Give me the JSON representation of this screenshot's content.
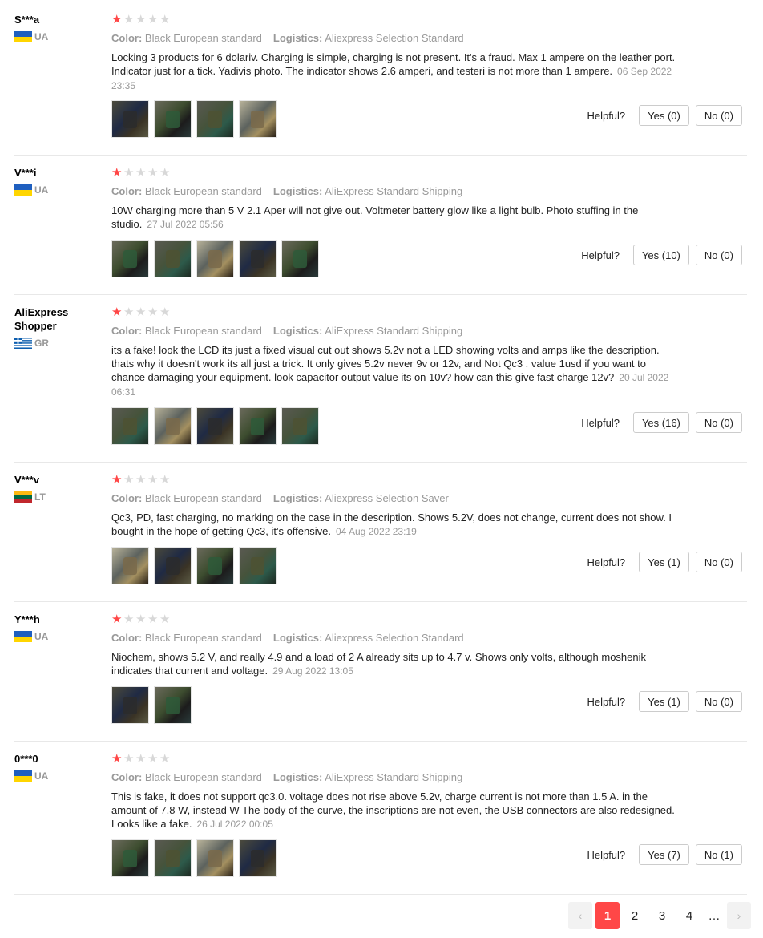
{
  "labels": {
    "color": "Color:",
    "logistics": "Logistics:",
    "helpful": "Helpful?"
  },
  "colors": {
    "accent": "#ff4747",
    "muted": "#999999",
    "border": "#e8e8e8"
  },
  "reviews": [
    {
      "user": "S***a",
      "country": "UA",
      "flag": "ukraine-flag-icon",
      "rating": 1,
      "color": "Black European standard",
      "logistics": "Aliexpress Selection Standard",
      "text": "Locking 3 products for 6 dolariv. Charging is simple, charging is not present. It's a fraud. Max 1 ampere on the leather port. Indicator just for a tick. Yadivis photo. The indicator shows 2.6 amperi, and testeri is not more than 1 ampere.",
      "date": "06 Sep 2022 23:35",
      "photos": [
        "charger-photo-1",
        "charger-photo-2",
        "charger-photo-3",
        "charger-photo-4"
      ],
      "yes": "Yes (0)",
      "no": "No (0)"
    },
    {
      "user": "V***i",
      "country": "UA",
      "flag": "ukraine-flag-icon",
      "rating": 1,
      "color": "Black European standard",
      "logistics": "AliExpress Standard Shipping",
      "text": "10W charging more than 5 V 2.1 Aper will not give out. Voltmeter battery glow like a light bulb. Photo stuffing in the studio.",
      "date": "27 Jul 2022 05:56",
      "photos": [
        "charger-photo-1",
        "charger-photo-2",
        "charger-photo-3",
        "charger-photo-4",
        "charger-photo-5"
      ],
      "yes": "Yes (10)",
      "no": "No (0)"
    },
    {
      "user": "AliExpress Shopper",
      "country": "GR",
      "flag": "greece-flag-icon",
      "rating": 1,
      "color": "Black European standard",
      "logistics": "AliExpress Standard Shipping",
      "text": "its a fake! look the LCD its just a fixed visual cut out shows 5.2v not a LED showing volts and amps like the description. thats why it doesn't work its all just a trick. It only gives 5.2v never 9v or 12v, and Not Qc3 . value 1usd if you want to chance damaging your equipment. look capacitor output value its on 10v? how can this give fast charge 12v?",
      "date": "20 Jul 2022 06:31",
      "photos": [
        "charger-photo-1",
        "charger-photo-2",
        "charger-photo-3",
        "charger-photo-4",
        "charger-photo-5"
      ],
      "yes": "Yes (16)",
      "no": "No (0)"
    },
    {
      "user": "V***v",
      "country": "LT",
      "flag": "lithuania-flag-icon",
      "rating": 1,
      "color": "Black European standard",
      "logistics": "Aliexpress Selection Saver",
      "text": "Qc3, PD, fast charging, no marking on the case in the description. Shows 5.2V, does not change, current does not show. I bought in the hope of getting Qc3, it's offensive.",
      "date": "04 Aug 2022 23:19",
      "photos": [
        "charger-photo-1",
        "charger-photo-2",
        "charger-photo-3",
        "charger-photo-4"
      ],
      "yes": "Yes (1)",
      "no": "No (0)"
    },
    {
      "user": "Y***h",
      "country": "UA",
      "flag": "ukraine-flag-icon",
      "rating": 1,
      "color": "Black European standard",
      "logistics": "Aliexpress Selection Standard",
      "text": "Niochem, shows 5.2 V, and really 4.9 and a load of 2 A already sits up to 4.7 v. Shows only volts, although moshenik indicates that current and voltage.",
      "date": "29 Aug 2022 13:05",
      "photos": [
        "charger-photo-1",
        "charger-photo-2"
      ],
      "yes": "Yes (1)",
      "no": "No (0)"
    },
    {
      "user": "0***0",
      "country": "UA",
      "flag": "ukraine-flag-icon",
      "rating": 1,
      "color": "Black European standard",
      "logistics": "AliExpress Standard Shipping",
      "text": "This is fake, it does not support qc3.0. voltage does not rise above 5.2v, charge current is not more than 1.5 A. in the amount of 7.8 W, instead W The body of the curve, the inscriptions are not even, the USB connectors are also redesigned. Looks like a fake.",
      "date": "26 Jul 2022 00:05",
      "photos": [
        "charger-photo-1",
        "charger-photo-2",
        "charger-photo-3",
        "charger-photo-4"
      ],
      "yes": "Yes (7)",
      "no": "No (1)"
    }
  ],
  "pagination": {
    "prev": "‹",
    "pages": [
      "1",
      "2",
      "3",
      "4"
    ],
    "current": "1",
    "ellipsis": "…",
    "next": "›"
  }
}
